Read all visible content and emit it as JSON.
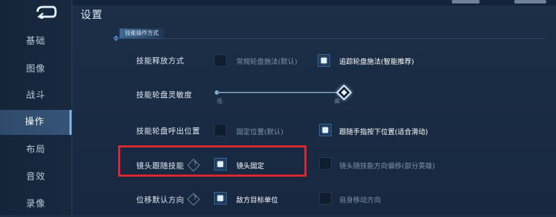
{
  "window": {
    "title": "设置"
  },
  "sidebar": {
    "items": [
      {
        "label": "基础",
        "active": false
      },
      {
        "label": "图像",
        "active": false
      },
      {
        "label": "战斗",
        "active": false
      },
      {
        "label": "操作",
        "active": true
      },
      {
        "label": "布局",
        "active": false
      },
      {
        "label": "音效",
        "active": false
      },
      {
        "label": "录像",
        "active": false
      }
    ]
  },
  "section": {
    "title": "技能操作方式"
  },
  "rows": {
    "cast_mode": {
      "label": "技能释放方式",
      "options": [
        {
          "label": "常规轮盘施法(默认)",
          "checked": false
        },
        {
          "label": "追踪轮盘施法(智能推荐)",
          "checked": true
        }
      ]
    },
    "sensitivity": {
      "label": "技能轮盘灵敏度",
      "min_label": "低",
      "max_label": "高",
      "value_fraction": 1.0
    },
    "wheel_position": {
      "label": "技能轮盘呼出位置",
      "options": [
        {
          "label": "固定位置(默认)",
          "checked": false
        },
        {
          "label": "跟随手指按下位置(适合滑动)",
          "checked": true
        }
      ]
    },
    "camera_follow": {
      "label": "镜头跟随技能",
      "options": [
        {
          "label": "镜头固定",
          "checked": true
        },
        {
          "label": "镜头随技能方向偏移(部分英雄)",
          "checked": false
        }
      ]
    },
    "move_direction": {
      "label": "位移默认方向",
      "options": [
        {
          "label": "敌方目标单位",
          "checked": true
        },
        {
          "label": "自身移动方向",
          "checked": false
        }
      ]
    }
  },
  "help_glyph": "?",
  "colors": {
    "highlight": "#e0262e",
    "accent": "#7fb8e8"
  }
}
